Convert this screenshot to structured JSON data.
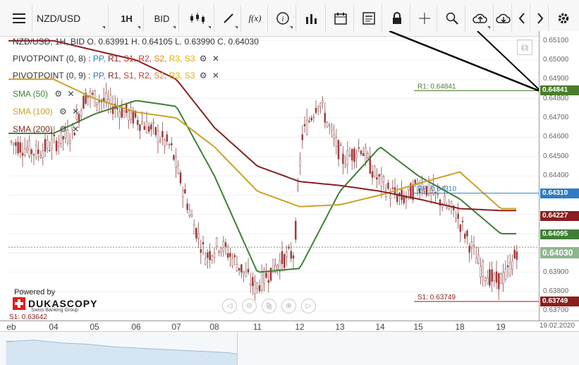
{
  "toolbar": {
    "menu_icon": "hamburger-menu-icon",
    "symbol": "NZD/USD",
    "timeframe": "1H",
    "price_side": "BID",
    "icons": [
      "candlestick-chart-icon",
      "pencil-icon",
      "function-icon",
      "info-icon",
      "bar-chart-icon",
      "calendar-icon",
      "news-icon",
      "lock-icon",
      "crosshair-icon",
      "zoom-icon",
      "upload-icon",
      "download-icon",
      "chevron-left-icon",
      "chevron-right-icon",
      "gear-icon"
    ]
  },
  "legend": {
    "header": "NZD/USD, 1H, BID    O. 0.63991 H. 0.64105 L. 0.63990 C. 0.64030",
    "pivot1": "PIVOTPOINT (0, 8)",
    "pivot2": "PIVOTPOINT (0, 9)",
    "pivot_parts": [
      "PP, ",
      "R1, ",
      "S1, ",
      "R2, ",
      "S2, ",
      "R3, ",
      "S3"
    ],
    "sma50": "SMA (50)",
    "sma100": "SMA (100)",
    "sma200": "SMA (200)"
  },
  "chart_annotations": {
    "r1": "R1: 0.64841",
    "pp": "PP: 0.64310",
    "s1": "S1: 0.63749",
    "s1_left": "S1: 0.63642"
  },
  "price_axis": {
    "ticks": [
      "0.65100",
      "0.65000",
      "0.64900",
      "0.64800",
      "0.64700",
      "0.64600",
      "0.64500",
      "0.64400",
      "0.64300",
      "0.64200",
      "0.64100",
      "0.64000",
      "0.63900",
      "0.63800",
      "0.63700"
    ],
    "badges": [
      "0.64841",
      "0.64310",
      "0.64227",
      "0.64095",
      "0.64030",
      "0.63749"
    ]
  },
  "x_axis": {
    "labels": [
      "eb",
      "04",
      "05",
      "06",
      "07",
      "08",
      "11",
      "12",
      "13",
      "14",
      "15",
      "18",
      "19",
      "19.02.2020"
    ]
  },
  "branding": {
    "powered": "Powered by",
    "name": "DUKASCOPY",
    "tagline": "Swiss Banking Group"
  },
  "colors": {
    "sma50": "#3f7f35",
    "sma100": "#c9a227",
    "sma200": "#8b1e1e",
    "pp": "#2f7cc2",
    "r1": "#4b7d2b",
    "s1": "#8b1e1e",
    "candle": "#b03030"
  },
  "chart_data": {
    "type": "line",
    "symbol": "NZD/USD",
    "timeframe": "1H",
    "x": [
      "04",
      "05",
      "06",
      "07",
      "08",
      "11",
      "12",
      "13",
      "14",
      "15",
      "18",
      "19"
    ],
    "ylim": [
      0.6365,
      0.6515
    ],
    "series": [
      {
        "name": "SMA (50)",
        "values": [
          0.6462,
          0.6472,
          0.6479,
          0.6476,
          0.644,
          0.639,
          0.6392,
          0.6432,
          0.6455,
          0.644,
          0.6428,
          0.641
        ]
      },
      {
        "name": "SMA (100)",
        "values": [
          0.649,
          0.648,
          0.6473,
          0.647,
          0.6455,
          0.6432,
          0.6424,
          0.6425,
          0.643,
          0.6436,
          0.6442,
          0.6423
        ]
      },
      {
        "name": "SMA (200)",
        "values": [
          0.651,
          0.6505,
          0.65,
          0.649,
          0.6465,
          0.6445,
          0.6437,
          0.6435,
          0.6432,
          0.6428,
          0.6423,
          0.6422
        ]
      }
    ],
    "levels": {
      "R1": 0.64841,
      "PP": 0.6431,
      "S1": 0.63749,
      "last": 0.6403
    }
  }
}
